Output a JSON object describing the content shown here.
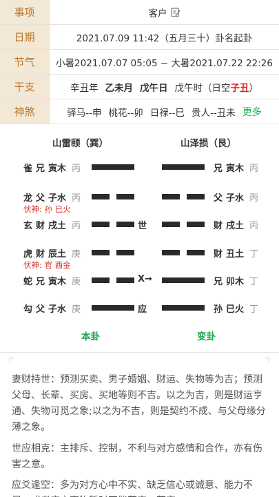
{
  "info": {
    "rows": [
      {
        "label": "事项",
        "value": "客户"
      },
      {
        "label": "日期",
        "value": "2021.07.09 11:42（五月三十）卦名起卦"
      },
      {
        "label": "节气",
        "value": "小暑2021.07.07 05:05 ~ 大暑2021.07.22 22:26"
      },
      {
        "label": "干支",
        "p1": "辛丑年",
        "p2": "乙未月",
        "p3": "戊午日",
        "p4": "戊午时（日空",
        "p5": "子丑",
        "p6": "）"
      },
      {
        "label": "神煞",
        "s1": "驿马--申",
        "s2": "桃花--卯",
        "s3": "日禄--巳",
        "s4": "贵人--丑未",
        "more": "更多"
      }
    ]
  },
  "hexagram": {
    "left_name": "山雷颐（巽）",
    "right_name": "山泽损（艮）",
    "lines": [
      {
        "beast": "雀",
        "rel": "兄",
        "zhi": "寅木",
        "gan": "丙",
        "yang": true,
        "mark": "",
        "r_rel": "兄",
        "r_zhi": "寅木",
        "r_gan": "丙",
        "r_yang": true
      },
      {
        "beast": "龙",
        "rel": "父",
        "zhi": "子水",
        "gan": "丙",
        "yang": false,
        "mark": "",
        "r_rel": "父",
        "r_zhi": "子水",
        "r_gan": "丙",
        "r_yang": false,
        "fushen": "伏神: 孙  巳火"
      },
      {
        "beast": "玄",
        "rel": "财",
        "zhi": "戌土",
        "gan": "丙",
        "yang": false,
        "mark": "世",
        "r_rel": "财",
        "r_zhi": "戌土",
        "r_gan": "丙",
        "r_yang": false
      },
      {
        "beast": "虎",
        "rel": "财",
        "zhi": "辰土",
        "gan": "庚",
        "yang": false,
        "mark": "",
        "r_rel": "财",
        "r_zhi": "丑土",
        "r_gan": "丁",
        "r_yang": false,
        "fushen": "伏神: 官  酉金"
      },
      {
        "beast": "蛇",
        "rel": "兄",
        "zhi": "寅木",
        "gan": "庚",
        "yang": false,
        "mark": "X→",
        "r_rel": "兄",
        "r_zhi": "卯木",
        "r_gan": "丁",
        "r_yang": true
      },
      {
        "beast": "勾",
        "rel": "父",
        "zhi": "子水",
        "gan": "庚",
        "yang": true,
        "mark": "应",
        "r_rel": "孙",
        "r_zhi": "巳火",
        "r_gan": "丁",
        "r_yang": true
      }
    ],
    "left_footer": "本卦",
    "right_footer": "变卦"
  },
  "description": {
    "p1": "妻财持世：预测买卖、男子婚姻、财运、失物等为吉；预测父母、长辈、买房、买地等则不吉。以之为吉，则是财运亨通、失物可觅之象;以之为不吉，则是契约不成、与父母缘分薄之象。",
    "p2": "世应相克：主排斥、控制，不利与对方感情和合作，亦有伤害之意。",
    "p3": "应爻逢空：多为对方心中不实、缺乏信心或诚意、能力不足，或者应之事物暂时不能落实、落空。"
  }
}
